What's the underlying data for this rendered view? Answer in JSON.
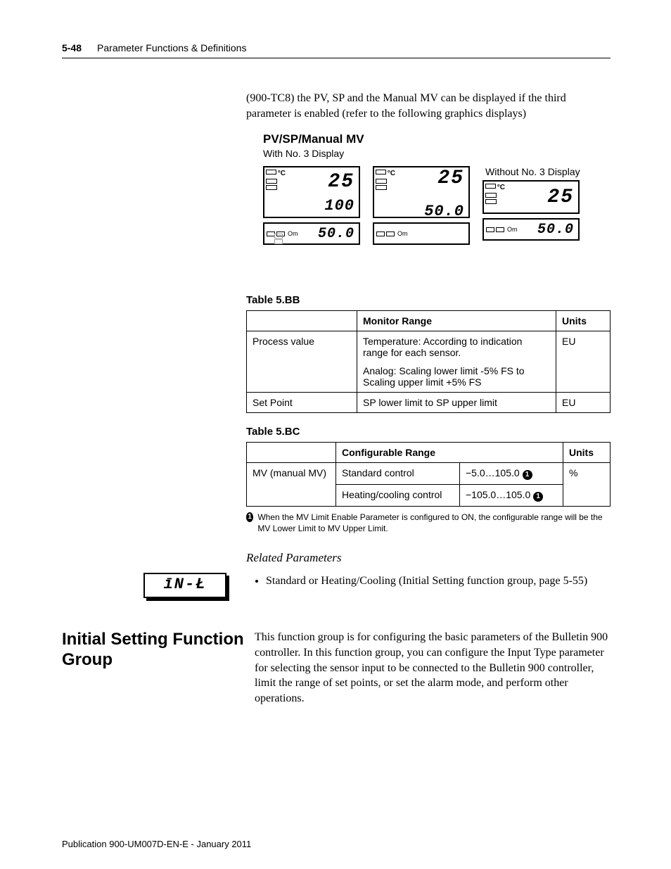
{
  "header": {
    "page_number": "5-48",
    "chapter_title": "Parameter Functions & Definitions"
  },
  "intro": "(900-TC8) the PV, SP and the Manual MV can be displayed if the third parameter is enabled (refer to the following graphics displays)",
  "pvsp": {
    "title": "PV/SP/Manual MV",
    "subtitle": "With No. 3 Display",
    "without_label": "Without No. 3 Display",
    "displays": {
      "d1_main_top": "25",
      "d1_main_mid": "100",
      "d1_small": "50.0",
      "d2_main_top": "25",
      "d2_main_bot": "50.0",
      "d3_main_top": "25",
      "d3_small": "50.0",
      "om_label": "Om",
      "deg_label": "°C"
    }
  },
  "tableBB": {
    "caption": "Table 5.BB",
    "head_c2": "Monitor Range",
    "head_c3": "Units",
    "rows": [
      {
        "c1": "Process value",
        "c2a": "Temperature: According to indication range for each sensor.",
        "c2b": "Analog: Scaling lower limit -5% FS to Scaling upper limit +5% FS",
        "c3": "EU"
      },
      {
        "c1": "Set Point",
        "c2": "SP lower limit to SP upper limit",
        "c3": "EU"
      }
    ]
  },
  "tableBC": {
    "caption": "Table 5.BC",
    "head_c2": "Configurable Range",
    "head_c3": "Units",
    "row1_c1": "MV (manual MV)",
    "row1_c2": "Standard control",
    "row1_c3": "−5.0…105.0",
    "row1_c4": "%",
    "row2_c2": "Heating/cooling control",
    "row2_c3": "−105.0…105.0",
    "footnote_mark": "➊",
    "footnote": "When the MV Limit Enable Parameter is configured to ON, the configurable range will be the MV Lower Limit to MV Upper Limit."
  },
  "seg_box": "īN-Ł",
  "related": {
    "heading": "Related Parameters",
    "item1": "Standard or Heating/Cooling (Initial Setting function group, page 5-55)"
  },
  "section": {
    "title": "Initial Setting Function Group",
    "body": "This function group is for configuring the basic parameters of the Bulletin 900 controller. In this function group, you can configure the Input Type parameter for selecting the sensor input to be connected to the Bulletin 900 controller, limit the range of set points, or set the alarm mode, and perform other operations."
  },
  "footer": "Publication 900-UM007D-EN-E - January 2011"
}
